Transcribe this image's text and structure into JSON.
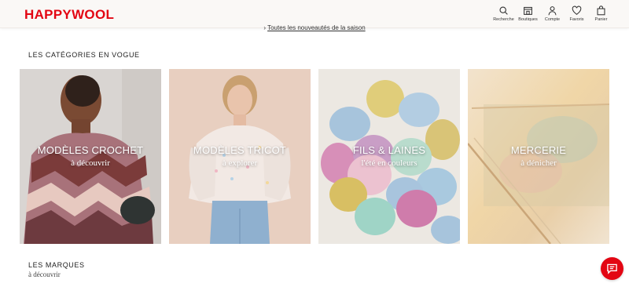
{
  "header": {
    "logo": "HAPPYWOOL",
    "nav": [
      {
        "label": "Recherche",
        "icon": "search-icon"
      },
      {
        "label": "Boutiques",
        "icon": "store-icon"
      },
      {
        "label": "Compte",
        "icon": "user-icon"
      },
      {
        "label": "Favoris",
        "icon": "heart-icon"
      },
      {
        "label": "Panier",
        "icon": "bag-icon"
      }
    ]
  },
  "promo": {
    "prefix": "› ",
    "link": "Toutes les nouveautés de la saison"
  },
  "categories_section": {
    "title": "LES CATÉGORIES EN VOGUE",
    "cards": [
      {
        "title": "MODÈLES CROCHET",
        "subtitle": "à découvrir"
      },
      {
        "title": "MODÈLES TRICOT",
        "subtitle": "à explorer"
      },
      {
        "title": "FILS & LAINES",
        "subtitle": "l'été en couleurs"
      },
      {
        "title": "MERCERIE",
        "subtitle": "à dénicher"
      }
    ]
  },
  "brands_section": {
    "title": "LES MARQUES",
    "subtitle": "à découvrir"
  },
  "colors": {
    "brand": "#e30613"
  }
}
